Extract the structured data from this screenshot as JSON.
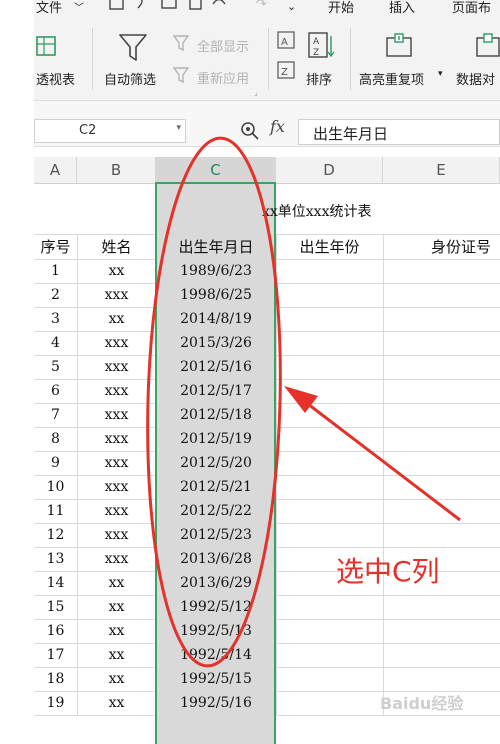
{
  "menu": {
    "file_label": "文件",
    "start_label": "开始",
    "insert_label": "插入",
    "page_layout_label": "页面布"
  },
  "ribbon": {
    "pivot_label": "透视表",
    "autofilter_label": "自动筛选",
    "show_all_label": "全部显示",
    "reapply_label": "重新应用",
    "sort_label": "排序",
    "highlight_dup_label": "高亮重复项",
    "data_compare_label": "数据对"
  },
  "formula_bar": {
    "cell_ref": "C2",
    "fx_label": "fx",
    "content": "出生年月日"
  },
  "columns": [
    "A",
    "B",
    "C",
    "D",
    "E"
  ],
  "selected_column": "C",
  "sheet": {
    "title": "xx单位xxx统计表",
    "headers": [
      "序号",
      "姓名",
      "出生年月日",
      "出生年份",
      "身份证号"
    ],
    "rows": [
      [
        "1",
        "xx",
        "1989/6/23"
      ],
      [
        "2",
        "xxx",
        "1998/6/25"
      ],
      [
        "3",
        "xx",
        "2014/8/19"
      ],
      [
        "4",
        "xxx",
        "2015/3/26"
      ],
      [
        "5",
        "xxx",
        "2012/5/16"
      ],
      [
        "6",
        "xxx",
        "2012/5/17"
      ],
      [
        "7",
        "xxx",
        "2012/5/18"
      ],
      [
        "8",
        "xxx",
        "2012/5/19"
      ],
      [
        "9",
        "xxx",
        "2012/5/20"
      ],
      [
        "10",
        "xxx",
        "2012/5/21"
      ],
      [
        "11",
        "xxx",
        "2012/5/22"
      ],
      [
        "12",
        "xxx",
        "2012/5/23"
      ],
      [
        "13",
        "xxx",
        "2013/6/28"
      ],
      [
        "14",
        "xx",
        "2013/6/29"
      ],
      [
        "15",
        "xx",
        "1992/5/12"
      ],
      [
        "16",
        "xx",
        "1992/5/13"
      ],
      [
        "17",
        "xx",
        "1992/5/14"
      ],
      [
        "18",
        "xx",
        "1992/5/15"
      ],
      [
        "19",
        "xx",
        "1992/5/16"
      ]
    ]
  },
  "annotation": {
    "text": "选中C列",
    "color": "#e4322b"
  },
  "watermark": "Baidu经验",
  "colors": {
    "selection_border": "#3aa561",
    "selection_fill": "#d9d9d9",
    "annotation_red": "#e4322b"
  }
}
